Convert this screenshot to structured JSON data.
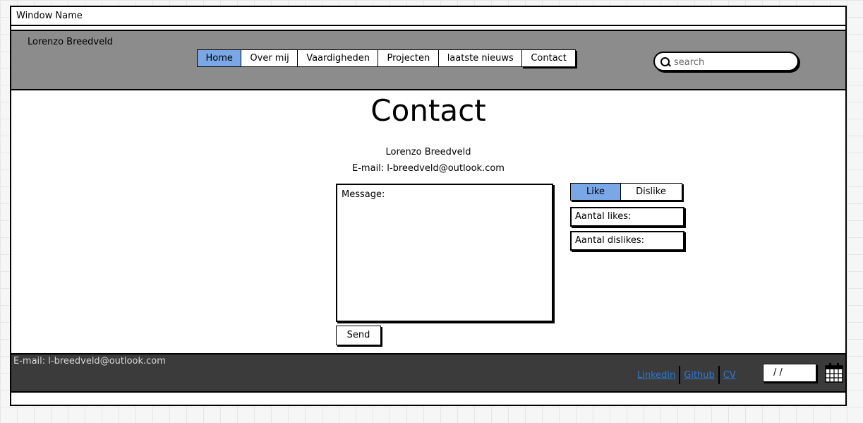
{
  "window": {
    "title": "Window Name"
  },
  "header": {
    "brand": "Lorenzo Breedveld",
    "nav": [
      {
        "label": "Home",
        "active": true
      },
      {
        "label": "Over mij",
        "active": false
      },
      {
        "label": "Vaardigheden",
        "active": false
      },
      {
        "label": "Projecten",
        "active": false
      },
      {
        "label": "laatste nieuws",
        "active": false
      },
      {
        "label": "Contact",
        "active": false
      }
    ],
    "search": {
      "placeholder": "search",
      "icon": "search-icon"
    }
  },
  "main": {
    "title": "Contact",
    "name": "Lorenzo Breedveld",
    "email": "E-mail: l-breedveld@outlook.com",
    "message_placeholder": "Message:",
    "send_label": "Send",
    "vote": {
      "like_label": "Like",
      "dislike_label": "Dislike",
      "selected": "Like"
    },
    "likes_label": "Aantal likes:",
    "dislikes_label": "Aantal dislikes:"
  },
  "footer": {
    "email": "E-mail: l-breedveld@outlook.com",
    "links": [
      "Linkedin",
      "Github",
      "CV"
    ],
    "date_value": "/ /",
    "calendar_icon": "calendar-icon"
  },
  "colors": {
    "header_bg": "#8c8c8c",
    "footer_bg": "#3b3b3b",
    "accent": "#7aa7e6",
    "link": "#2b79d6"
  }
}
